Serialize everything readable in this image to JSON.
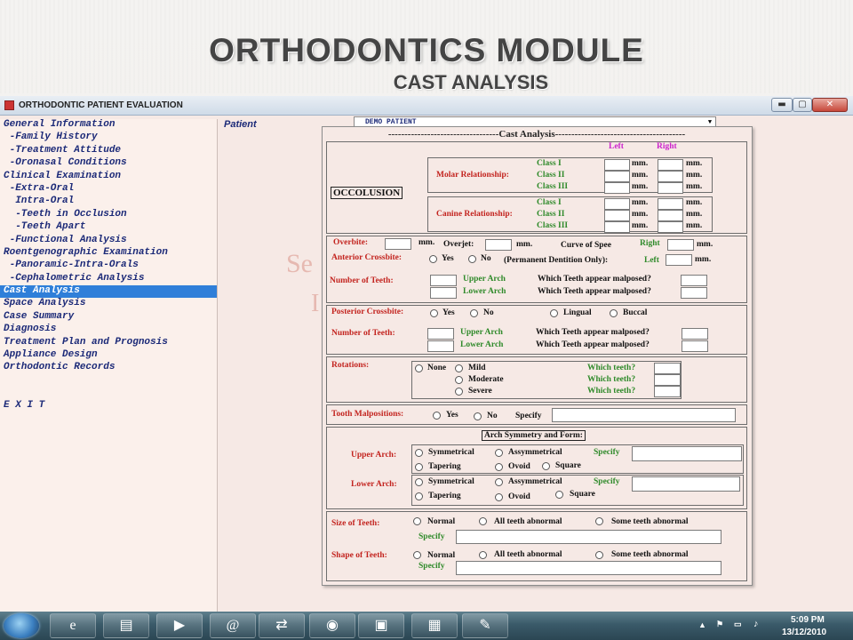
{
  "slide": {
    "title": "ORTHODONTICS MODULE",
    "subtitle": "CAST ANALYSIS"
  },
  "window": {
    "title": "ORTHODONTIC PATIENT EVALUATION",
    "buttons": {
      "minimize": "▬",
      "maximize": "▢",
      "close": "✕"
    }
  },
  "sidebar": {
    "items": [
      {
        "label": "General Information"
      },
      {
        "label": " -Family History"
      },
      {
        "label": " -Treatment Attitude"
      },
      {
        "label": " -Oronasal Conditions"
      },
      {
        "label": "Clinical Examination"
      },
      {
        "label": " -Extra-Oral"
      },
      {
        "label": "  Intra-Oral"
      },
      {
        "label": "  -Teeth in Occlusion"
      },
      {
        "label": "  -Teeth Apart"
      },
      {
        "label": " -Functional Analysis"
      },
      {
        "label": "Roentgenographic Examination"
      },
      {
        "label": " -Panoramic-Intra-Orals"
      },
      {
        "label": " -Cephalometric Analysis"
      },
      {
        "label": "Cast Analysis"
      },
      {
        "label": "Space Analysis"
      },
      {
        "label": "Case Summary"
      },
      {
        "label": "Diagnosis"
      },
      {
        "label": "Treatment Plan and Prognosis"
      },
      {
        "label": "Appliance Design"
      },
      {
        "label": "Orthodontic Records"
      }
    ],
    "active": "Cast Analysis",
    "exit": "E X I T"
  },
  "patient": {
    "label": "Patient",
    "selected": "DEMO PATIENT"
  },
  "background_text": {
    "line1": "Se",
    "line2": "I"
  },
  "form": {
    "header": "----------------------------------Cast Analysis----------------------------------------",
    "occlusion": {
      "title": "OCCOLUSION",
      "left": "Left",
      "right": "Right",
      "molar_label": "Molar Relationship:",
      "canine_label": "Canine Relationship:",
      "classes": [
        "Class I",
        "Class II",
        "Class III"
      ],
      "unit": "mm."
    },
    "anterior": {
      "overbite": "Overbite:",
      "overjet": "Overjet:",
      "mm": "mm.",
      "curve_of_spee": "Curve of Spee",
      "right": "Right",
      "left": "Left",
      "anterior_crossbite": "Anterior Crossbite:",
      "yes": "Yes",
      "no": "No",
      "permanent": "(Permanent Dentition Only):",
      "number_of_teeth": "Number of Teeth:",
      "upper_arch": "Upper Arch",
      "lower_arch": "Lower Arch",
      "which_malposed": "Which Teeth appear malposed?"
    },
    "posterior": {
      "posterior_crossbite": "Posterior Crossbite:",
      "yes": "Yes",
      "no": "No",
      "lingual": "Lingual",
      "buccal": "Buccal",
      "number_of_teeth": "Number of Teeth:",
      "upper_arch": "Upper Arch",
      "lower_arch": "Lower Arch",
      "which_malposed": "Which Teeth appear malposed?"
    },
    "rotations": {
      "label": "Rotations:",
      "none": "None",
      "mild": "Mild",
      "moderate": "Moderate",
      "severe": "Severe",
      "which_teeth": "Which teeth?"
    },
    "malpositions": {
      "label": "Tooth Malpositions:",
      "yes": "Yes",
      "no": "No",
      "specify": "Specify"
    },
    "arch_symmetry": {
      "title": "Arch Symmetry and Form:",
      "upper": "Upper Arch:",
      "lower": "Lower Arch:",
      "symmetrical": "Symmetrical",
      "assymmetrical": "Assymmetrical",
      "specify": "Specify",
      "tapering": "Tapering",
      "ovoid": "Ovoid",
      "square": "Square"
    },
    "teeth_size_shape": {
      "size": "Size of Teeth:",
      "shape": "Shape of Teeth:",
      "normal": "Normal",
      "all_abnormal": "All teeth abnormal",
      "some_abnormal": "Some teeth abnormal",
      "specify": "Specify"
    }
  },
  "taskbar": {
    "time": "5:09 PM",
    "date": "13/12/2010"
  }
}
